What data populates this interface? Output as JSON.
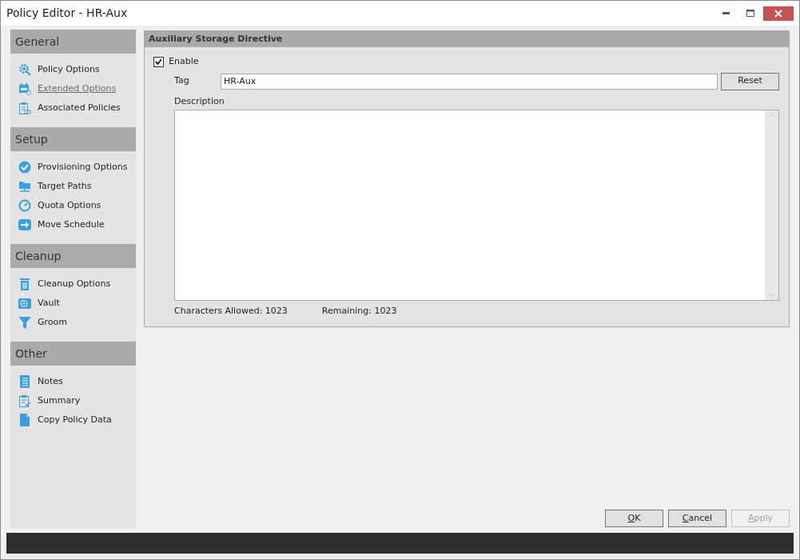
{
  "window": {
    "title": "Policy Editor - HR-Aux"
  },
  "sidebar": {
    "sections": [
      {
        "title": "General",
        "items": [
          {
            "label": "Policy Options",
            "selected": false
          },
          {
            "label": "Extended Options",
            "selected": true
          },
          {
            "label": "Associated Policies",
            "selected": false
          }
        ]
      },
      {
        "title": "Setup",
        "items": [
          {
            "label": "Provisioning Options",
            "selected": false
          },
          {
            "label": "Target Paths",
            "selected": false
          },
          {
            "label": "Quota Options",
            "selected": false
          },
          {
            "label": "Move Schedule",
            "selected": false
          }
        ]
      },
      {
        "title": "Cleanup",
        "items": [
          {
            "label": "Cleanup Options",
            "selected": false
          },
          {
            "label": "Vault",
            "selected": false
          },
          {
            "label": "Groom",
            "selected": false
          }
        ]
      },
      {
        "title": "Other",
        "items": [
          {
            "label": "Notes",
            "selected": false
          },
          {
            "label": "Summary",
            "selected": false
          },
          {
            "label": "Copy Policy Data",
            "selected": false
          }
        ]
      }
    ]
  },
  "panel": {
    "title": "Auxiliary Storage Directive",
    "enable": {
      "label": "Enable",
      "checked": true
    },
    "tag": {
      "label": "Tag",
      "value": "HR-Aux"
    },
    "reset_button": "Reset",
    "description": {
      "label": "Description"
    },
    "chars_allowed": "Characters Allowed: 1023",
    "remaining": "Remaining: 1023"
  },
  "buttons": [
    {
      "access_key": "O",
      "rest": "K",
      "disabled": false
    },
    {
      "access_key": "C",
      "rest": "ancel",
      "disabled": false
    },
    {
      "access_key": "A",
      "rest": "pply",
      "disabled": true
    }
  ]
}
